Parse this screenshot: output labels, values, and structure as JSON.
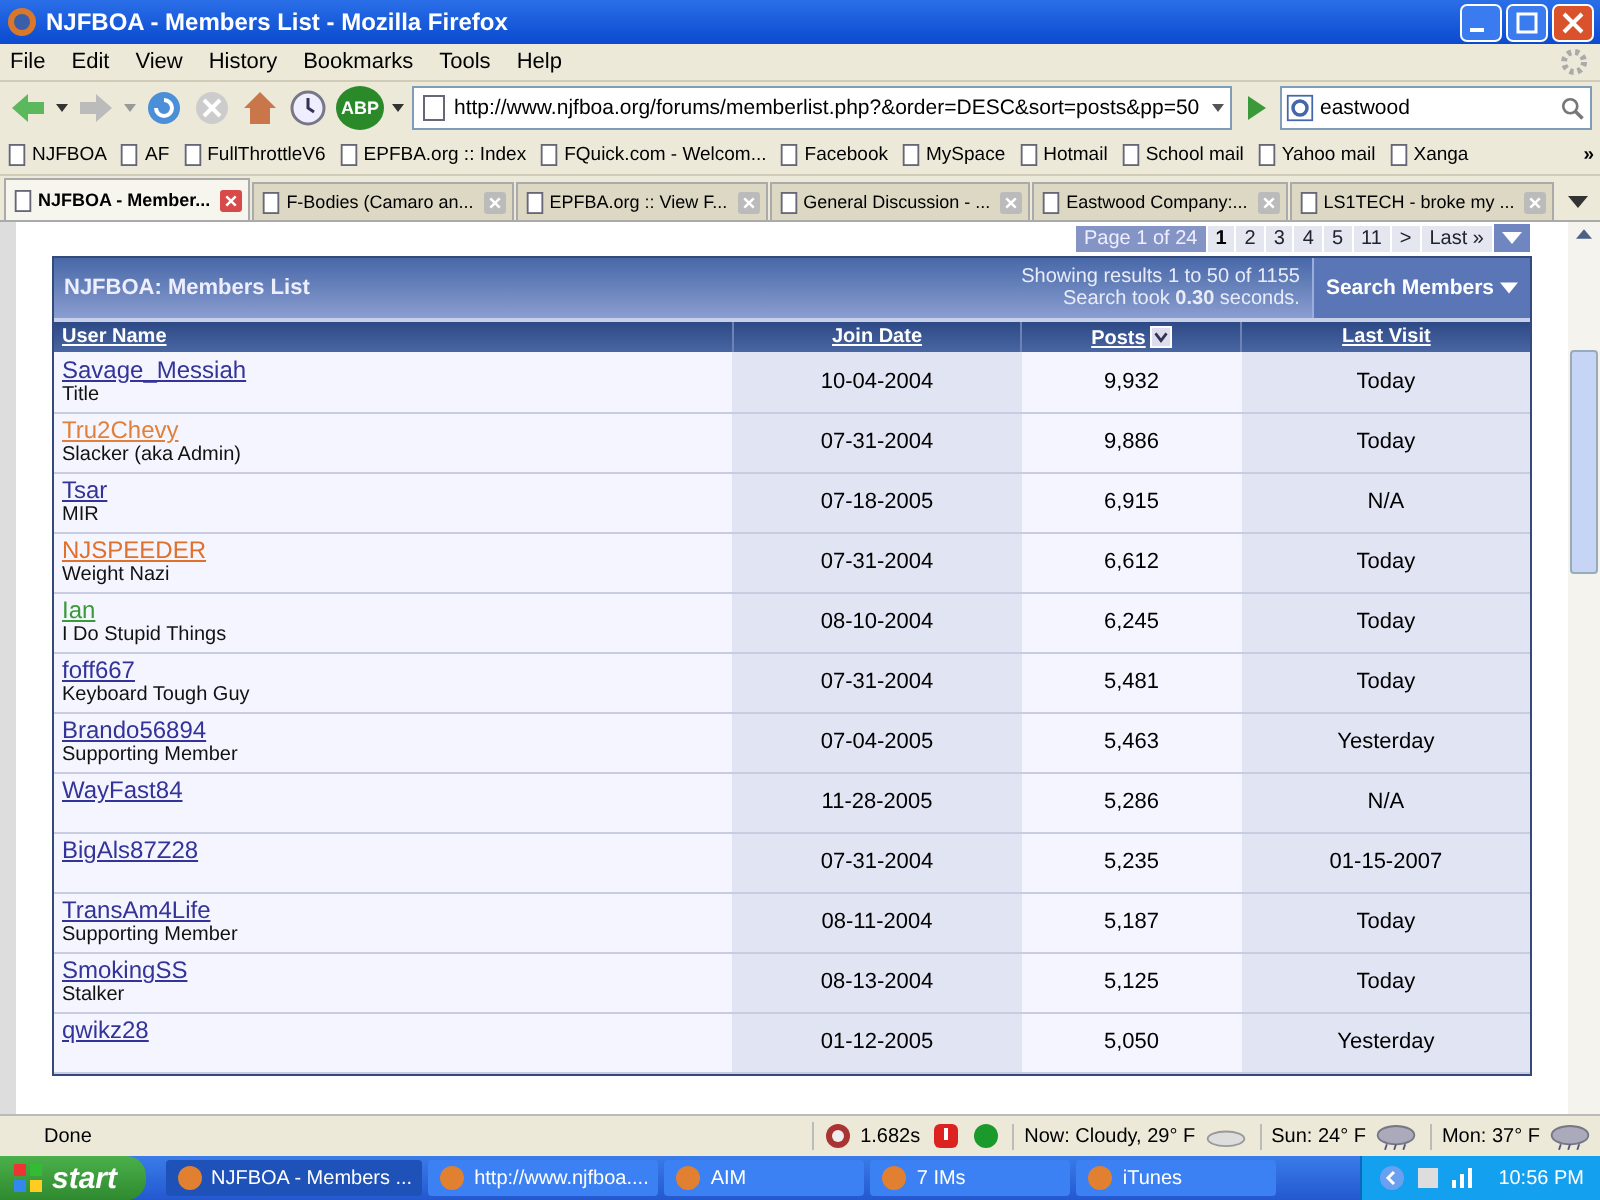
{
  "window": {
    "title": "NJFBOA - Members List - Mozilla Firefox"
  },
  "menu": [
    "File",
    "Edit",
    "View",
    "History",
    "Bookmarks",
    "Tools",
    "Help"
  ],
  "address": {
    "value": "http://www.njfboa.org/forums/memberlist.php?&order=DESC&sort=posts&pp=50"
  },
  "search": {
    "value": "eastwood"
  },
  "adblock": {
    "label": "ABP"
  },
  "bookmarks": [
    "NJFBOA",
    "AF",
    "FullThrottleV6",
    "EPFBA.org :: Index",
    "FQuick.com - Welcom...",
    "Facebook",
    "MySpace",
    "Hotmail",
    "School mail",
    "Yahoo mail",
    "Xanga"
  ],
  "bookmarks_more": "»",
  "tabs": [
    {
      "label": "NJFBOA - Member...",
      "selected": true
    },
    {
      "label": "F-Bodies (Camaro an...",
      "selected": false
    },
    {
      "label": "EPFBA.org :: View F...",
      "selected": false
    },
    {
      "label": "General Discussion - ...",
      "selected": false
    },
    {
      "label": "Eastwood Company:...",
      "selected": false
    },
    {
      "label": "LS1TECH - broke my ...",
      "selected": false
    }
  ],
  "pagination": {
    "summary": "Page 1 of 24",
    "pages": [
      {
        "label": "1",
        "selected": true
      },
      {
        "label": "2",
        "selected": false
      },
      {
        "label": "3",
        "selected": false
      },
      {
        "label": "4",
        "selected": false
      },
      {
        "label": "5",
        "selected": false
      },
      {
        "label": "11",
        "selected": false
      },
      {
        "label": ">",
        "selected": false
      },
      {
        "label": "Last »",
        "selected": false
      }
    ]
  },
  "panel": {
    "title": "NJFBOA: Members List",
    "showing": "Showing results 1 to 50 of 1155",
    "took": "Search took **0.30** seconds.",
    "search_button": "Search Members"
  },
  "table": {
    "columns": [
      "User Name",
      "Join Date",
      "Posts",
      "Last Visit"
    ],
    "rows": [
      {
        "name": "Savage_Messiah",
        "color": "#333399",
        "title": "Title",
        "joined": "10-04-2004",
        "posts": "9,932",
        "last": "Today"
      },
      {
        "name": "Tru2Chevy",
        "color": "#e0803a",
        "title": "Slacker (aka Admin)",
        "joined": "07-31-2004",
        "posts": "9,886",
        "last": "Today"
      },
      {
        "name": "Tsar",
        "color": "#333399",
        "title": "MIR",
        "joined": "07-18-2005",
        "posts": "6,915",
        "last": "N/A"
      },
      {
        "name": "NJSPEEDER",
        "color": "#e0702a",
        "title": "Weight Nazi",
        "joined": "07-31-2004",
        "posts": "6,612",
        "last": "Today"
      },
      {
        "name": "Ian",
        "color": "#3a9a3a",
        "title": "I Do Stupid Things",
        "joined": "08-10-2004",
        "posts": "6,245",
        "last": "Today"
      },
      {
        "name": "foff667",
        "color": "#333399",
        "title": "Keyboard Tough Guy",
        "joined": "07-31-2004",
        "posts": "5,481",
        "last": "Today"
      },
      {
        "name": "Brando56894",
        "color": "#333399",
        "title": "Supporting Member",
        "joined": "07-04-2005",
        "posts": "5,463",
        "last": "Yesterday"
      },
      {
        "name": "WayFast84",
        "color": "#333399",
        "joined": "11-28-2005",
        "posts": "5,286",
        "last": "N/A"
      },
      {
        "name": "BigAls87Z28",
        "color": "#333399",
        "joined": "07-31-2004",
        "posts": "5,235",
        "last": "01-15-2007"
      },
      {
        "name": "TransAm4Life",
        "color": "#333399",
        "title": "Supporting Member",
        "joined": "08-11-2004",
        "posts": "5,187",
        "last": "Today"
      },
      {
        "name": "SmokingSS",
        "color": "#333399",
        "title": "Stalker",
        "joined": "08-13-2004",
        "posts": "5,125",
        "last": "Today"
      },
      {
        "name": "qwikz28",
        "color": "#333399",
        "joined": "01-12-2005",
        "posts": "5,050",
        "last": "Yesterday"
      }
    ]
  },
  "status_bar": {
    "text": "Done",
    "timing": "1.682s",
    "now": "Now: Cloudy, 29° F",
    "sun": "Sun: 24° F",
    "mon": "Mon: 37° F"
  },
  "taskbar": {
    "start": "start",
    "tasks": [
      {
        "label": "NJFBOA - Members ...",
        "selected": true
      },
      {
        "label": "http://www.njfboa....",
        "selected": false
      },
      {
        "label": "AIM",
        "selected": false
      },
      {
        "label": "7 IMs",
        "selected": false
      },
      {
        "label": "iTunes",
        "selected": false
      }
    ],
    "clock": "10:56 PM"
  }
}
